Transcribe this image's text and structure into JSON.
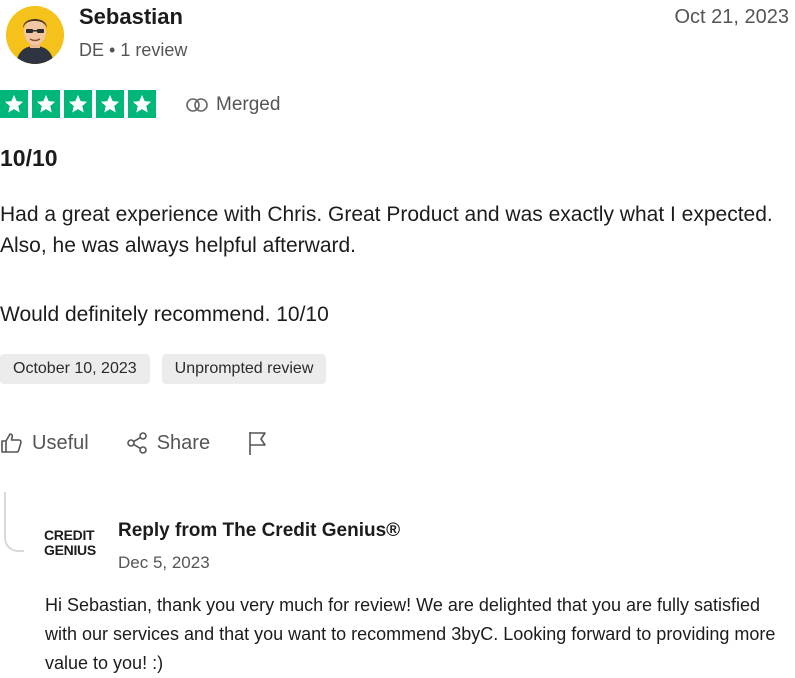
{
  "reviewer": {
    "name": "Sebastian",
    "country": "DE",
    "separator": "•",
    "review_count": "1 review"
  },
  "review": {
    "date": "Oct 21, 2023",
    "rating": 5,
    "rating_max": 5,
    "rating_color": "#00b67a",
    "merged_label": "Merged",
    "title": "10/10",
    "paragraphs": [
      "Had a great experience with Chris. Great Product and was exactly what I expected. Also, he was always helpful afterward.",
      "Would definitely recommend. 10/10"
    ],
    "tags": [
      "October 10, 2023",
      "Unprompted review"
    ]
  },
  "actions": {
    "useful_label": "Useful",
    "share_label": "Share"
  },
  "reply": {
    "logo_line1": "CREDIT",
    "logo_line2": "GENIUS",
    "title": "Reply from The Credit Genius®",
    "date": "Dec 5, 2023",
    "body": "Hi Sebastian, thank you very much for review! We are delighted that you are fully satisfied with our services and that you want to recommend 3byC. Looking forward to providing more value to you! :)"
  },
  "icons": {
    "avatar": "avatar-icon",
    "star": "star-icon",
    "merged": "merged-icon",
    "useful": "thumbs-up-icon",
    "share": "share-icon",
    "flag": "flag-icon"
  }
}
